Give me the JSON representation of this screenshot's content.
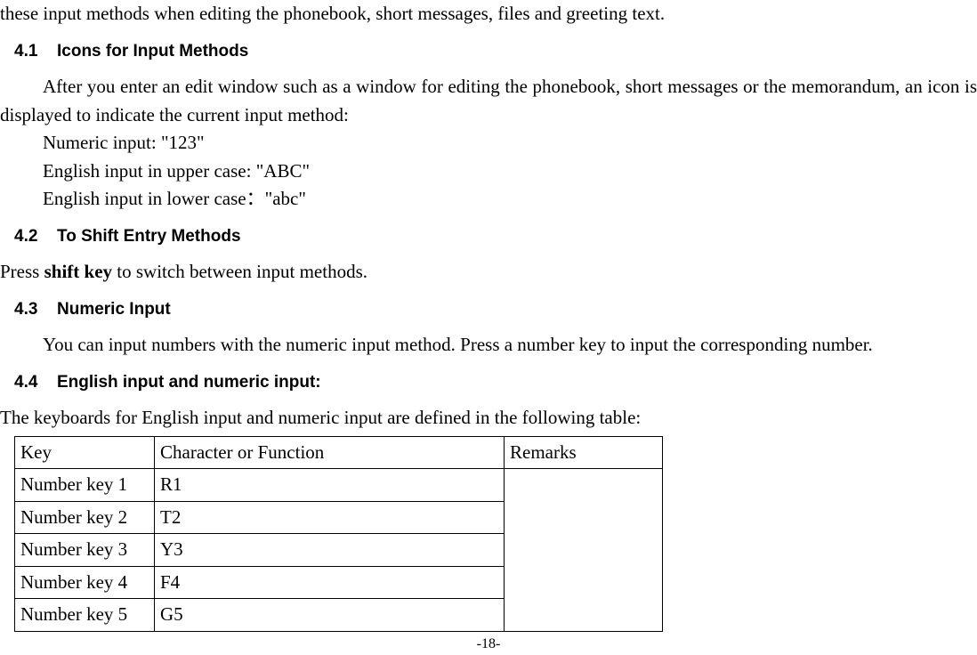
{
  "intro": "these input methods when editing the phonebook, short messages, files and greeting text.",
  "sections": {
    "s41": {
      "num": "4.1",
      "title": "Icons for Input Methods",
      "body1": "After you enter an edit window such as a window for editing the phonebook, short messages or the memorandum, an icon is displayed to indicate the current input method:",
      "line1": "Numeric input:  \"123\"",
      "line2": "English input in upper case:  \"ABC\"",
      "line3": "English input in lower case：\"abc\""
    },
    "s42": {
      "num": "4.2",
      "title": "To Shift Entry Methods",
      "body_pre": "Press ",
      "body_bold": "shift key",
      "body_post": " to switch between input methods."
    },
    "s43": {
      "num": "4.3",
      "title": "Numeric Input",
      "body": "You can input numbers with the numeric input method. Press a number key to input the corresponding number."
    },
    "s44": {
      "num": "4.4",
      "title": "English input and numeric input:",
      "body": "The keyboards for English input and numeric input are defined in the following table:"
    }
  },
  "table": {
    "header": {
      "key": "Key",
      "char": "Character or Function",
      "remarks": "Remarks"
    },
    "rows": [
      {
        "key": "Number key 1",
        "char": "R1"
      },
      {
        "key": "Number key 2",
        "char": "T2"
      },
      {
        "key": "Number key 3",
        "char": "Y3"
      },
      {
        "key": "Number key 4",
        "char": "F4"
      },
      {
        "key": "Number key 5",
        "char": "G5"
      }
    ]
  },
  "page_number": "-18-"
}
